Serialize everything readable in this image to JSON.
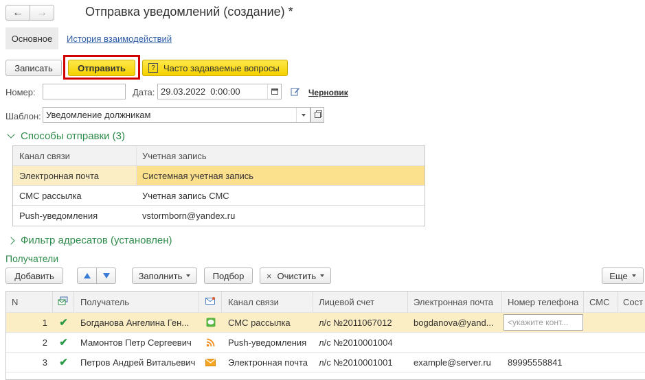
{
  "window": {
    "title": "Отправка уведомлений (создание) *",
    "back_glyph": "←",
    "forward_glyph": "→"
  },
  "tabs": [
    {
      "label": "Основное",
      "active": true
    },
    {
      "label": "История взаимодействий",
      "active": false
    }
  ],
  "toolbar": {
    "save_label": "Записать",
    "send_label": "Отправить",
    "faq_icon": "?",
    "faq_label": "Часто задаваемые вопросы"
  },
  "form": {
    "number_label": "Номер:",
    "number_value": "",
    "date_label": "Дата:",
    "date_value": "29.03.2022  0:00:00",
    "status_label": "Черновик",
    "template_label": "Шаблон:",
    "template_value": "Уведомление должникам"
  },
  "channels_section": {
    "title": "Способы отправки (3)",
    "columns": [
      "Канал связи",
      "Учетная запись"
    ],
    "rows": [
      {
        "channel": "Электронная почта",
        "account": "Системная учетная запись",
        "selected": true
      },
      {
        "channel": "СМС рассылка",
        "account": "Учетная запись СМС",
        "selected": false
      },
      {
        "channel": "Push-уведомления",
        "account": "vstormborn@yandex.ru",
        "selected": false
      }
    ]
  },
  "filter_section": {
    "title": "Фильтр адресатов (установлен)"
  },
  "recipients": {
    "title": "Получатели",
    "add_label": "Добавить",
    "fill_label": "Заполнить",
    "pick_label": "Подбор",
    "clear_icon": "×",
    "clear_label": "Очистить",
    "more_label": "Еще",
    "columns": {
      "n": "N",
      "recipient": "Получатель",
      "channel": "Канал связи",
      "account": "Лицевой счет",
      "email": "Электронная почта",
      "phone": "Номер телефона",
      "sms": "СМС",
      "status": "Сост"
    },
    "rows": [
      {
        "n": "1",
        "recipient": "Богданова Ангелина Ген...",
        "channel_icon": "sms-icon",
        "channel": "СМС рассылка",
        "account": "л/с №2011067012",
        "email": "bogdanova@yand...",
        "phone_placeholder": "<укажите конт...",
        "phone": "",
        "selected": true
      },
      {
        "n": "2",
        "recipient": "Мамонтов Петр Сергеевич",
        "channel_icon": "push-icon",
        "channel": "Push-уведомления",
        "account": "л/с №2010001004",
        "email": "",
        "phone": "",
        "selected": false
      },
      {
        "n": "3",
        "recipient": "Петров Андрей Витальевич",
        "channel_icon": "email-icon",
        "channel": "Электронная почта",
        "account": "л/с №2010001001",
        "email": "example@server.ru",
        "phone": "89995558841",
        "selected": false
      }
    ]
  },
  "colors": {
    "accent_green": "#2e8b4a",
    "highlight_red": "#d00000",
    "button_yellow": "#f5d000",
    "selection": "#fbe08e"
  }
}
